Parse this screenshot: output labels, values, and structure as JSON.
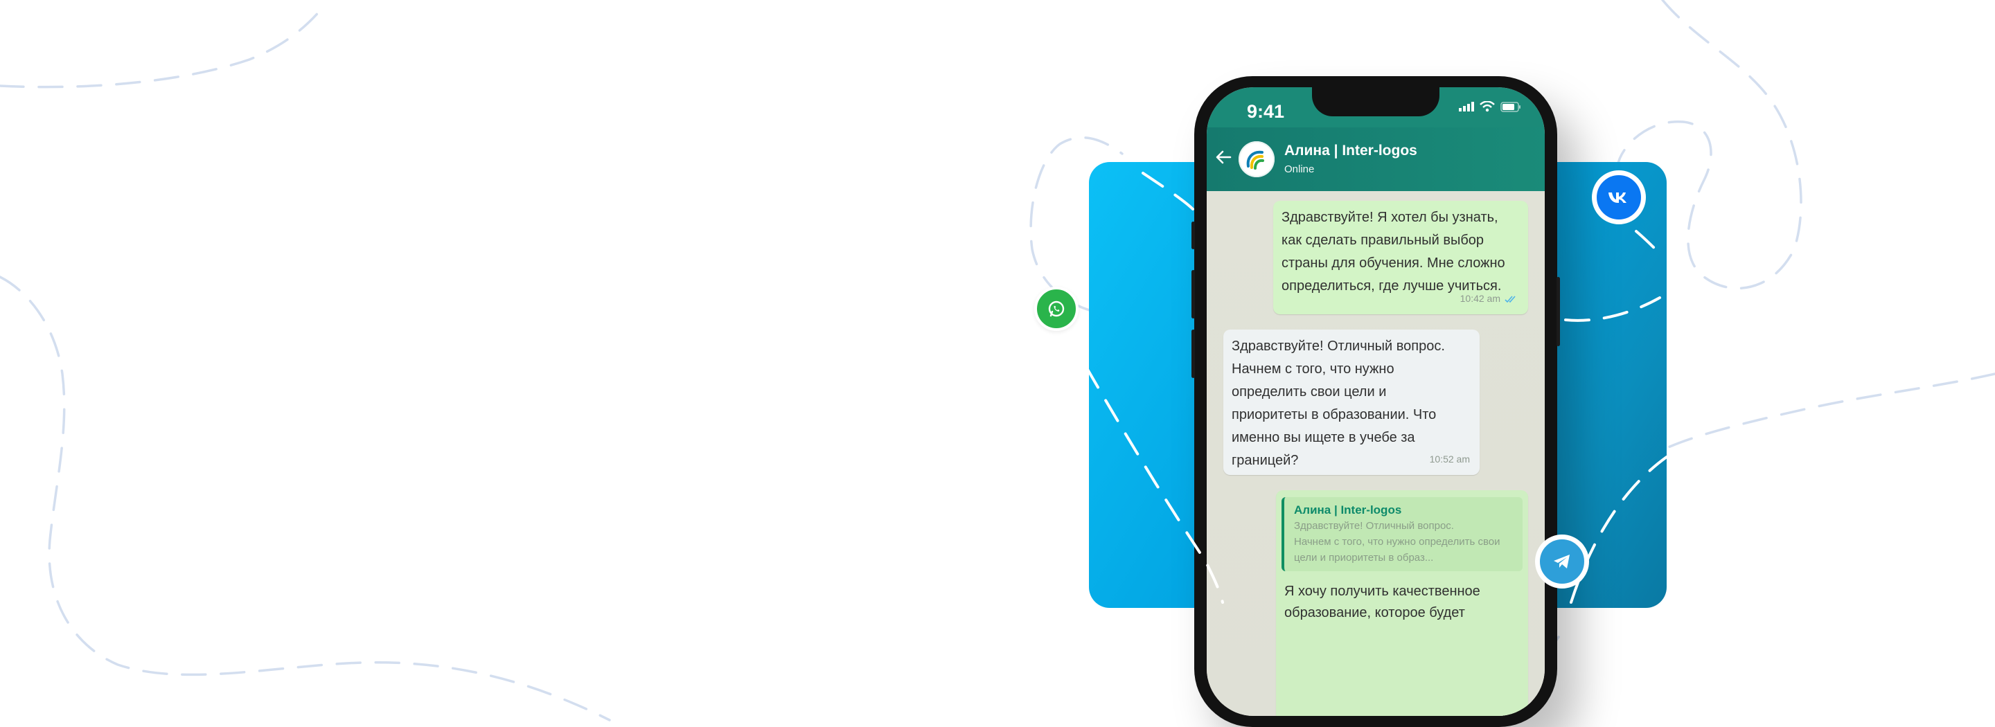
{
  "colors": {
    "panel": "#02a4e2",
    "header": "#1a8b79",
    "outgoing_bubble": "#d3f4c6",
    "incoming_bubble": "#eef2f3",
    "whatsapp": "#2ab44b",
    "vk": "#0a77f2",
    "telegram": "#2e9fd9"
  },
  "status_bar": {
    "time": "9:41",
    "icons": [
      "signal-icon",
      "wifi-icon",
      "battery-icon"
    ]
  },
  "chat_header": {
    "back_icon": "arrow-left-icon",
    "contact_name": "Алина | Inter-logos",
    "contact_status": "Online"
  },
  "messages": [
    {
      "direction": "outgoing",
      "lines": [
        "Здравствуйте! Я хотел бы узнать,",
        "как сделать правильный выбор",
        "страны для обучения. Мне сложно",
        "определиться, где лучше учиться."
      ],
      "time": "10:42 am",
      "read": true
    },
    {
      "direction": "incoming",
      "lines": [
        "Здравствуйте! Отличный вопрос.",
        "Начнем с того, что нужно",
        "определить свои цели и",
        "приоритеты в образовании. Что",
        "именно вы ищете в учебе за",
        "границей?"
      ],
      "time": "10:52 am"
    },
    {
      "direction": "outgoing",
      "quote_name": "Алина | Inter-logos",
      "quote_lines": [
        "Здравствуйте! Отличный вопрос.",
        "Начнем с того, что нужно определить свои",
        "цели и приоритеты в образ..."
      ],
      "lines": [
        "Я хочу получить качественное",
        "образование, которое будет"
      ]
    }
  ],
  "social_icons": [
    "whatsapp-icon",
    "vk-icon",
    "telegram-icon"
  ]
}
